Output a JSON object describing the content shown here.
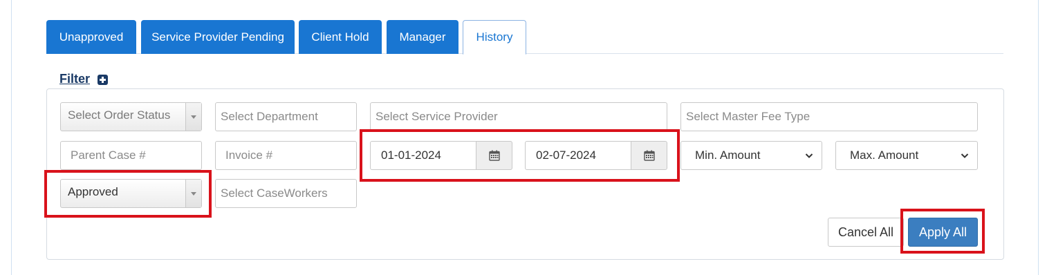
{
  "tabs": [
    {
      "label": "Unapproved"
    },
    {
      "label": "Service Provider Pending"
    },
    {
      "label": "Client Hold"
    },
    {
      "label": "Manager"
    },
    {
      "label": "History"
    }
  ],
  "active_tab": "History",
  "filter": {
    "label": "Filter",
    "order_status_placeholder": "Select Order Status",
    "department_placeholder": "Select Department",
    "service_provider_placeholder": "Select Service Provider",
    "master_fee_type_placeholder": "Select Master Fee Type",
    "parent_case_placeholder": "Parent Case #",
    "invoice_placeholder": "Invoice #",
    "date_from": "01-01-2024",
    "date_to": "02-07-2024",
    "min_amount": "Min. Amount",
    "max_amount": "Max. Amount",
    "approval_status": "Approved",
    "caseworkers_placeholder": "Select CaseWorkers"
  },
  "buttons": {
    "cancel_all": "Cancel All",
    "apply_all": "Apply All"
  },
  "colors": {
    "tab_active_bg": "#1976d2",
    "apply_button": "#3b7ec0",
    "highlight": "#d9121b",
    "filter_link": "#1a3a66"
  },
  "icons": [
    "plus-square-icon",
    "calendar-icon",
    "chevron-down-icon",
    "caret-down-icon"
  ]
}
